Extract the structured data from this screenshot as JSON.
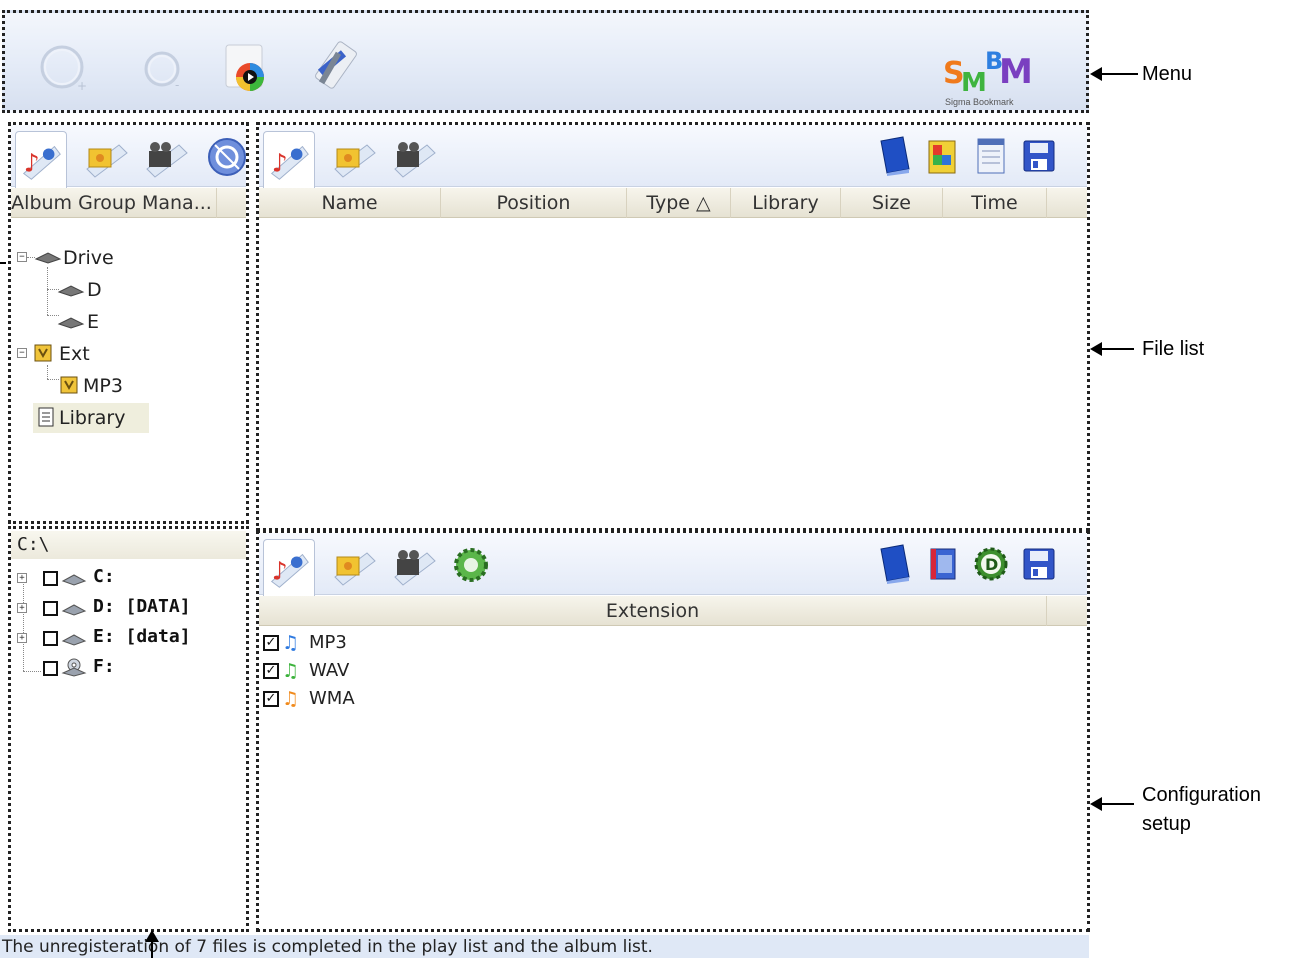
{
  "toolbar": {
    "icons": [
      "add-disc-icon",
      "remove-disc-icon",
      "media-player-icon",
      "tools-icon"
    ],
    "logo": {
      "letters": "SMBM",
      "caption": "Sigma Bookmark"
    }
  },
  "album_panel": {
    "tabs": [
      "music-tab",
      "photo-tab",
      "video-tab",
      "sync-tab"
    ],
    "header": "Album Group Mana...",
    "tree": {
      "drive": "Drive",
      "drive_children": [
        "D",
        "E"
      ],
      "ext": "Ext",
      "ext_children": [
        "MP3"
      ],
      "library": "Library"
    }
  },
  "file_panel": {
    "tabs": [
      "music-tab",
      "photo-tab",
      "video-tab"
    ],
    "tools": [
      "book-icon",
      "puzzle-icon",
      "notes-icon",
      "save-icon"
    ],
    "columns": [
      "Name",
      "Position",
      "Type △",
      "Library",
      "Size",
      "Time"
    ]
  },
  "drive_panel": {
    "path": "C:\\",
    "drives": [
      "C:",
      "D: [DATA]",
      "E: [data]",
      "F:"
    ]
  },
  "config_panel": {
    "tabs": [
      "music-tab",
      "photo-tab",
      "video-tab",
      "settings-tab"
    ],
    "tools": [
      "book-icon",
      "film-icon",
      "d-gear-icon",
      "save-icon"
    ],
    "column": "Extension",
    "extensions": [
      {
        "label": "MP3",
        "checked": true,
        "color": "#2f7ae0"
      },
      {
        "label": "WAV",
        "checked": true,
        "color": "#3bb23b"
      },
      {
        "label": "WMA",
        "checked": true,
        "color": "#f08a1c"
      }
    ]
  },
  "status": {
    "text": "The unregisteration of 7 files is completed in the play list and the album list."
  },
  "callouts": {
    "menu": "Menu",
    "file_list": "File list",
    "config_line1": "Configuration",
    "config_line2": "setup"
  }
}
